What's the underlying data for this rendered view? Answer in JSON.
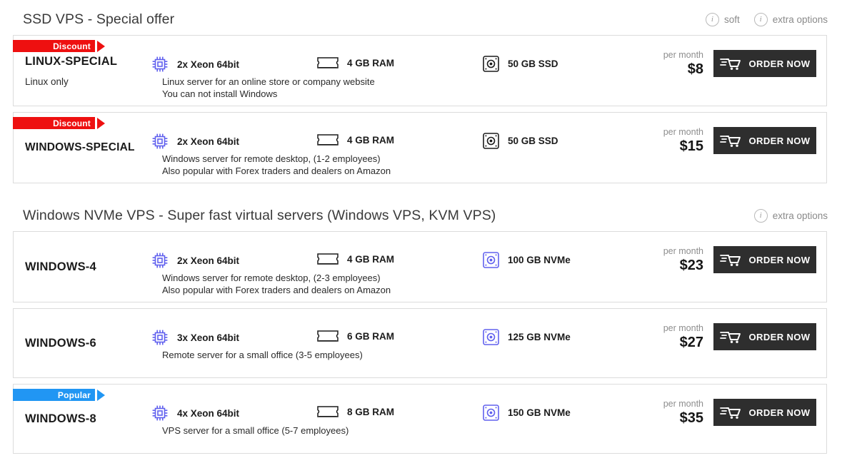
{
  "sections": [
    {
      "title": "SSD VPS - Special offer",
      "options": [
        {
          "label": "soft",
          "icon": "info-icon"
        },
        {
          "label": "extra options",
          "icon": "info-icon"
        }
      ],
      "plans": [
        {
          "badge": {
            "text": "Discount",
            "color": "#ee1010"
          },
          "name": "LINUX-SPECIAL",
          "subtitle": "Linux only",
          "cpu": "2x Xeon 64bit",
          "ram": "4 GB RAM",
          "disk": "50 GB SSD",
          "disk_icon_color": "#1b1b1b",
          "desc": [
            "Linux server for an online store or company website",
            "You can not install Windows"
          ],
          "per_month": "per month",
          "price": "$8",
          "order_label": "ORDER NOW"
        },
        {
          "badge": {
            "text": "Discount",
            "color": "#ee1010"
          },
          "name": "WINDOWS-SPECIAL",
          "subtitle": "",
          "cpu": "2x Xeon 64bit",
          "ram": "4 GB RAM",
          "disk": "50 GB SSD",
          "disk_icon_color": "#1b1b1b",
          "desc": [
            "Windows server for remote desktop, (1-2 employees)",
            "Also popular with Forex traders and dealers on Amazon"
          ],
          "per_month": "per month",
          "price": "$15",
          "order_label": "ORDER NOW"
        }
      ]
    },
    {
      "title": "Windows NVMe VPS - Super fast virtual servers (Windows VPS, KVM VPS)",
      "options": [
        {
          "label": "extra options",
          "icon": "info-icon"
        }
      ],
      "plans": [
        {
          "badge": null,
          "name": "WINDOWS-4",
          "subtitle": "",
          "cpu": "2x Xeon 64bit",
          "ram": "4 GB RAM",
          "disk": "100 GB NVMe",
          "disk_icon_color": "#6060ee",
          "desc": [
            "Windows server for remote desktop, (2-3 employees)",
            "Also popular with Forex traders and dealers on Amazon"
          ],
          "per_month": "per month",
          "price": "$23",
          "order_label": "ORDER NOW"
        },
        {
          "badge": null,
          "name": "WINDOWS-6",
          "subtitle": "",
          "cpu": "3x Xeon 64bit",
          "ram": "6 GB RAM",
          "disk": "125 GB NVMe",
          "disk_icon_color": "#6060ee",
          "desc": [
            "Remote server for a small office (3-5 employees)"
          ],
          "per_month": "per month",
          "price": "$27",
          "order_label": "ORDER NOW"
        },
        {
          "badge": {
            "text": "Popular",
            "color": "#2196f3"
          },
          "name": "WINDOWS-8",
          "subtitle": "",
          "cpu": "4x Xeon 64bit",
          "ram": "8 GB RAM",
          "disk": "150 GB NVMe",
          "disk_icon_color": "#6060ee",
          "desc": [
            "VPS server for a small office (5-7 employees)"
          ],
          "per_month": "per month",
          "price": "$35",
          "order_label": "ORDER NOW"
        }
      ]
    }
  ],
  "theme": {
    "cpu_icon_color": "#6060ee",
    "ram_icon_color": "#1b1b1b",
    "button_bg": "#2e2e2e",
    "card_border": "#dcdcdc"
  },
  "icons": {
    "cpu": "cpu-icon",
    "ram": "ram-icon",
    "disk": "disk-icon",
    "cart": "cart-icon",
    "info": "info-icon"
  }
}
